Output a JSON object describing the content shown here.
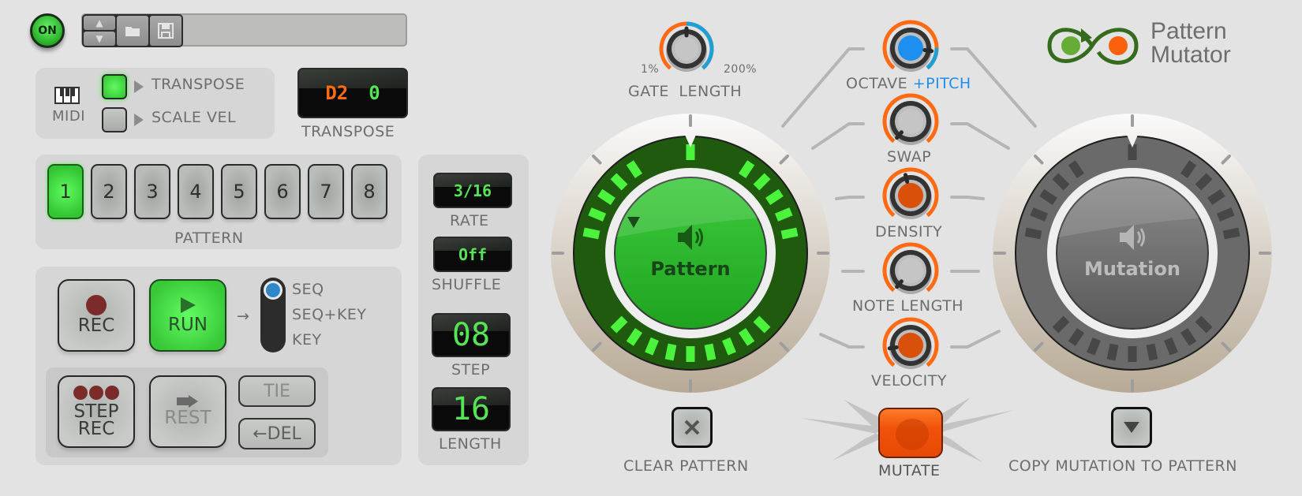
{
  "header": {
    "power_label": "ON",
    "preset_buttons": [
      {
        "name": "preset-up",
        "icon": "triangle-up"
      },
      {
        "name": "preset-down",
        "icon": "triangle-down"
      },
      {
        "name": "open-preset",
        "icon": "folder"
      },
      {
        "name": "save-preset",
        "icon": "floppy-disk"
      }
    ],
    "preset_name": ""
  },
  "midi": {
    "icon": "piano-keys-icon",
    "label": "MIDI",
    "transpose": {
      "label": "TRANSPOSE",
      "on": true
    },
    "scale_vel": {
      "label": "SCALE VEL",
      "on": false
    }
  },
  "transpose_display": {
    "note": "D2",
    "value": "0",
    "label": "TRANSPOSE",
    "note_color": "#ff6a13",
    "value_color": "#56e456"
  },
  "pattern": {
    "label": "PATTERN",
    "buttons": [
      "1",
      "2",
      "3",
      "4",
      "5",
      "6",
      "7",
      "8"
    ],
    "selected": "1"
  },
  "transport": {
    "rec_label": "REC",
    "run_label": "RUN",
    "run_active": true,
    "arrow": "→",
    "mode_options": [
      "SEQ",
      "SEQ+KEY",
      "KEY"
    ],
    "mode_selected": "SEQ",
    "step_rec_label_1": "STEP",
    "step_rec_label_2": "REC",
    "rest_label": "REST",
    "tie_label": "TIE",
    "del_label": "←DEL"
  },
  "sequencer": {
    "rate": {
      "value": "3/16",
      "label": "RATE"
    },
    "shuffle": {
      "value": "Off",
      "label": "SHUFFLE"
    },
    "step": {
      "value": "08",
      "label": "STEP"
    },
    "length": {
      "value": "16",
      "label": "LENGTH"
    },
    "lcd_color": "#56e456"
  },
  "gate_length": {
    "label": "GATE LENGTH",
    "min_label": "1%",
    "max_label": "200%",
    "value_fraction": 0.5
  },
  "mutation_knobs": [
    {
      "name": "octave",
      "label": "OCTAVE",
      "label_extra": "+PITCH",
      "value_fraction": 0.85,
      "center": "blue"
    },
    {
      "name": "swap",
      "label": "SWAP",
      "value_fraction": 0.0,
      "center": "gray"
    },
    {
      "name": "density",
      "label": "DENSITY",
      "value_fraction": 0.45,
      "center": "orange"
    },
    {
      "name": "note-length",
      "label": "NOTE LENGTH",
      "value_fraction": 0.0,
      "center": "gray"
    },
    {
      "name": "velocity",
      "label": "VELOCITY",
      "value_fraction": 0.15,
      "center": "orange"
    }
  ],
  "pattern_dial": {
    "label": "Pattern",
    "icon": "speaker-icon",
    "steps_total": 32,
    "active_steps": 16,
    "clear_label": "CLEAR PATTERN"
  },
  "mutation_dial": {
    "label": "Mutation",
    "icon": "speaker-icon",
    "copy_label": "COPY MUTATION TO PATTERN"
  },
  "mutate": {
    "label": "MUTATE"
  },
  "logo": {
    "line1": "Pattern",
    "line2": "Mutator"
  },
  "colors": {
    "accent_green": "#3ee63e",
    "accent_orange": "#ff6a13",
    "accent_blue": "#1e8fef",
    "bg": "#e3e3e3"
  }
}
